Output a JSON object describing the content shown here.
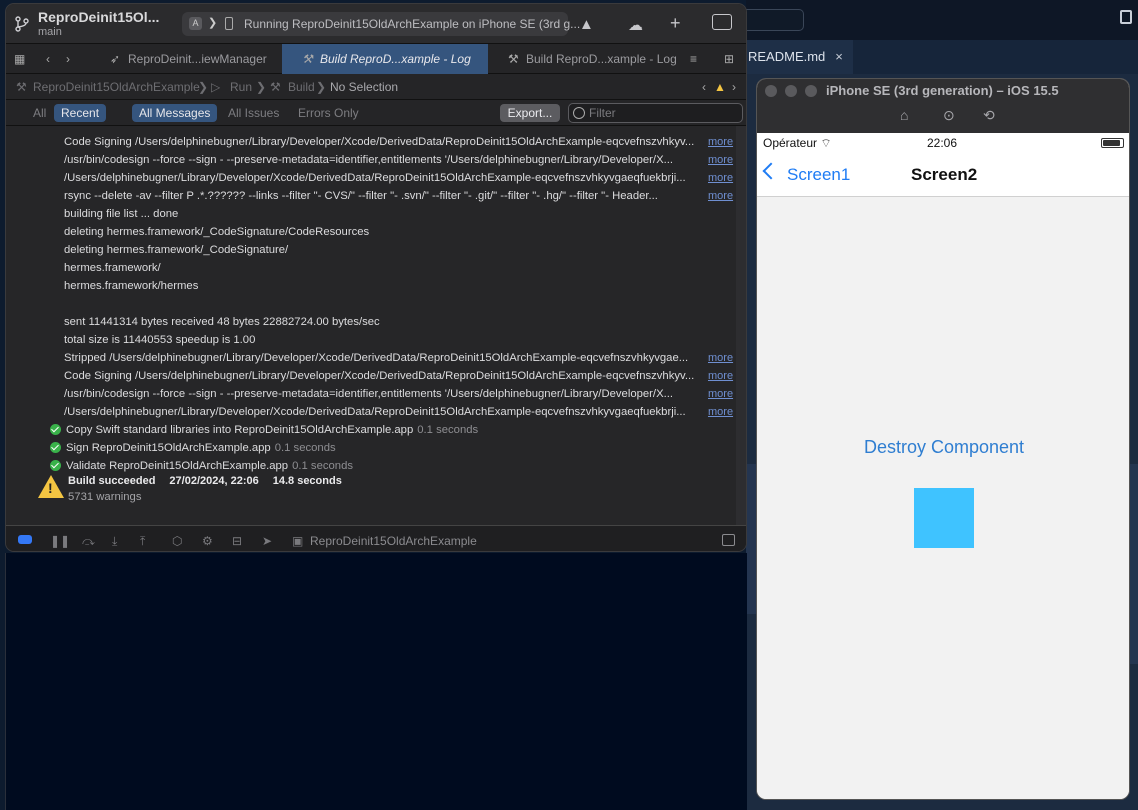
{
  "background_editor": {
    "tab_label": "README.md",
    "close_glyph": "×"
  },
  "xcode": {
    "project_name": "ReproDeinit15Ol...",
    "branch": "main",
    "status_text": "Running ReproDeinit15OldArchExample on iPhone SE (3rd g...",
    "tabs": [
      {
        "label": "ReproDeinit...iewManager",
        "active": false
      },
      {
        "label": "Build ReproD...xample - Log",
        "active": true
      },
      {
        "label": "Build ReproD...xample - Log",
        "active": false
      }
    ],
    "breadcrumb": {
      "project": "ReproDeinit15OldArchExample",
      "run": "Run",
      "build": "Build",
      "selection": "No Selection"
    },
    "filter_bar": {
      "all": "All",
      "recent": "Recent",
      "all_messages": "All Messages",
      "all_issues": "All Issues",
      "errors_only": "Errors Only",
      "export": "Export...",
      "filter_placeholder": "Filter"
    },
    "log_lines": [
      {
        "text": "Code Signing /Users/delphinebugner/Library/Developer/Xcode/DerivedData/ReproDeinit15OldArchExample-eqcvefnszvhkyv...",
        "more": "more"
      },
      {
        "text": "/usr/bin/codesign --force --sign -  --preserve-metadata=identifier,entitlements '/Users/delphinebugner/Library/Developer/X...",
        "more": "more"
      },
      {
        "text": "/Users/delphinebugner/Library/Developer/Xcode/DerivedData/ReproDeinit15OldArchExample-eqcvefnszvhkyvgaeqfuekbrji...",
        "more": "more"
      },
      {
        "text": "rsync --delete -av --filter P .*.?????? --links --filter \"- CVS/\" --filter \"- .svn/\" --filter \"- .git/\" --filter \"- .hg/\" --filter \"- Header...",
        "more": "more"
      },
      {
        "text": "building file list ... done",
        "more": ""
      },
      {
        "text": "deleting hermes.framework/_CodeSignature/CodeResources",
        "more": ""
      },
      {
        "text": "deleting hermes.framework/_CodeSignature/",
        "more": ""
      },
      {
        "text": "hermes.framework/",
        "more": ""
      },
      {
        "text": "hermes.framework/hermes",
        "more": ""
      },
      {
        "text": "",
        "more": ""
      },
      {
        "text": "sent 11441314 bytes  received 48 bytes  22882724.00 bytes/sec",
        "more": ""
      },
      {
        "text": "total size is 11440553  speedup is 1.00",
        "more": ""
      },
      {
        "text": "Stripped /Users/delphinebugner/Library/Developer/Xcode/DerivedData/ReproDeinit15OldArchExample-eqcvefnszvhkyvgae...",
        "more": "more"
      },
      {
        "text": "Code Signing /Users/delphinebugner/Library/Developer/Xcode/DerivedData/ReproDeinit15OldArchExample-eqcvefnszvhkyv...",
        "more": "more"
      },
      {
        "text": "/usr/bin/codesign --force --sign -  --preserve-metadata=identifier,entitlements '/Users/delphinebugner/Library/Developer/X...",
        "more": "more"
      },
      {
        "text": "/Users/delphinebugner/Library/Developer/Xcode/DerivedData/ReproDeinit15OldArchExample-eqcvefnszvhkyvgaeqfuekbrji...",
        "more": "more"
      }
    ],
    "steps": [
      {
        "label": "Copy Swift standard libraries into ReproDeinit15OldArchExample.app",
        "duration": "0.1 seconds"
      },
      {
        "label": "Sign ReproDeinit15OldArchExample.app",
        "duration": "0.1 seconds"
      },
      {
        "label": "Validate ReproDeinit15OldArchExample.app",
        "duration": "0.1 seconds"
      }
    ],
    "build_result": {
      "status": "Build succeeded",
      "timestamp": "27/02/2024, 22:06",
      "duration": "14.8 seconds",
      "warnings": "5731 warnings"
    },
    "debug_bar_label": "ReproDeinit15OldArchExample"
  },
  "simulator": {
    "title": "iPhone SE (3rd generation) – iOS 15.5",
    "carrier": "Opérateur",
    "time": "22:06",
    "back_label": "Screen1",
    "nav_title": "Screen2",
    "destroy_button": "Destroy Component",
    "box_color": "#3fc3ff"
  }
}
